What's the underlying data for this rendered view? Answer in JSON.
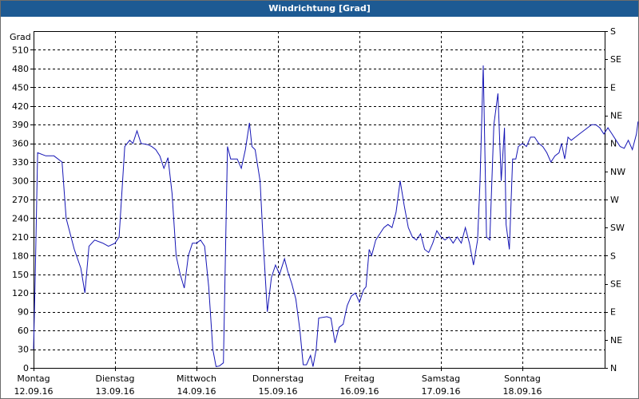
{
  "chart_data": {
    "type": "line",
    "title": "Windrichtung [Grad]",
    "ylabel": "Grad",
    "ylim": [
      0,
      540
    ],
    "y_ticks": [
      0,
      30,
      60,
      90,
      120,
      150,
      180,
      210,
      240,
      270,
      300,
      330,
      360,
      390,
      420,
      450,
      480,
      510
    ],
    "right_axis_labels": [
      {
        "value": 0,
        "label": "N"
      },
      {
        "value": 45,
        "label": "NE"
      },
      {
        "value": 90,
        "label": "E"
      },
      {
        "value": 135,
        "label": "SE"
      },
      {
        "value": 180,
        "label": "S"
      },
      {
        "value": 225,
        "label": "SW"
      },
      {
        "value": 270,
        "label": "W"
      },
      {
        "value": 315,
        "label": "NW"
      },
      {
        "value": 360,
        "label": "N"
      },
      {
        "value": 405,
        "label": "NE"
      },
      {
        "value": 450,
        "label": "E"
      },
      {
        "value": 495,
        "label": "SE"
      },
      {
        "value": 540,
        "label": "S"
      }
    ],
    "x_ticks": [
      {
        "day": "Montag",
        "date": "12.09.16"
      },
      {
        "day": "Dienstag",
        "date": "13.09.16"
      },
      {
        "day": "Mittwoch",
        "date": "14.09.16"
      },
      {
        "day": "Donnerstag",
        "date": "15.09.16"
      },
      {
        "day": "Freitag",
        "date": "16.09.16"
      },
      {
        "day": "Samstag",
        "date": "17.09.16"
      },
      {
        "day": "Sonntag",
        "date": "18.09.16"
      }
    ],
    "grid": true,
    "series": [
      {
        "color": "#1515b5",
        "points": [
          [
            0.0,
            30
          ],
          [
            0.02,
            140
          ],
          [
            0.05,
            345
          ],
          [
            0.15,
            340
          ],
          [
            0.25,
            340
          ],
          [
            0.35,
            330
          ],
          [
            0.4,
            240
          ],
          [
            0.5,
            190
          ],
          [
            0.58,
            160
          ],
          [
            0.63,
            120
          ],
          [
            0.68,
            195
          ],
          [
            0.75,
            205
          ],
          [
            0.85,
            200
          ],
          [
            0.92,
            195
          ],
          [
            1.0,
            200
          ],
          [
            1.05,
            210
          ],
          [
            1.12,
            355
          ],
          [
            1.18,
            365
          ],
          [
            1.22,
            360
          ],
          [
            1.27,
            380
          ],
          [
            1.32,
            360
          ],
          [
            1.4,
            358
          ],
          [
            1.45,
            355
          ],
          [
            1.5,
            350
          ],
          [
            1.55,
            340
          ],
          [
            1.6,
            320
          ],
          [
            1.65,
            337
          ],
          [
            1.7,
            280
          ],
          [
            1.75,
            180
          ],
          [
            1.8,
            150
          ],
          [
            1.85,
            128
          ],
          [
            1.9,
            180
          ],
          [
            1.95,
            200
          ],
          [
            2.0,
            200
          ],
          [
            2.05,
            205
          ],
          [
            2.1,
            195
          ],
          [
            2.15,
            130
          ],
          [
            2.2,
            30
          ],
          [
            2.24,
            2
          ],
          [
            2.28,
            3
          ],
          [
            2.33,
            8
          ],
          [
            2.38,
            355
          ],
          [
            2.42,
            335
          ],
          [
            2.5,
            335
          ],
          [
            2.55,
            320
          ],
          [
            2.6,
            350
          ],
          [
            2.65,
            393
          ],
          [
            2.68,
            355
          ],
          [
            2.72,
            350
          ],
          [
            2.78,
            300
          ],
          [
            2.82,
            200
          ],
          [
            2.87,
            90
          ],
          [
            2.92,
            145
          ],
          [
            2.97,
            165
          ],
          [
            3.02,
            150
          ],
          [
            3.08,
            175
          ],
          [
            3.12,
            155
          ],
          [
            3.17,
            135
          ],
          [
            3.22,
            110
          ],
          [
            3.27,
            60
          ],
          [
            3.31,
            5
          ],
          [
            3.35,
            5
          ],
          [
            3.4,
            20
          ],
          [
            3.43,
            2
          ],
          [
            3.47,
            30
          ],
          [
            3.5,
            80
          ],
          [
            3.6,
            82
          ],
          [
            3.65,
            80
          ],
          [
            3.7,
            40
          ],
          [
            3.75,
            65
          ],
          [
            3.8,
            70
          ],
          [
            3.85,
            100
          ],
          [
            3.9,
            115
          ],
          [
            3.95,
            120
          ],
          [
            4.0,
            105
          ],
          [
            4.05,
            125
          ],
          [
            4.08,
            130
          ],
          [
            4.12,
            190
          ],
          [
            4.15,
            180
          ],
          [
            4.2,
            205
          ],
          [
            4.25,
            215
          ],
          [
            4.3,
            225
          ],
          [
            4.35,
            230
          ],
          [
            4.4,
            225
          ],
          [
            4.45,
            250
          ],
          [
            4.5,
            300
          ],
          [
            4.55,
            260
          ],
          [
            4.6,
            225
          ],
          [
            4.65,
            210
          ],
          [
            4.7,
            205
          ],
          [
            4.75,
            215
          ],
          [
            4.8,
            190
          ],
          [
            4.85,
            185
          ],
          [
            4.9,
            200
          ],
          [
            4.95,
            220
          ],
          [
            5.0,
            210
          ],
          [
            5.05,
            205
          ],
          [
            5.1,
            210
          ],
          [
            5.15,
            200
          ],
          [
            5.2,
            210
          ],
          [
            5.25,
            200
          ],
          [
            5.3,
            225
          ],
          [
            5.35,
            200
          ],
          [
            5.4,
            165
          ],
          [
            5.45,
            205
          ],
          [
            5.48,
            300
          ],
          [
            5.52,
            485
          ],
          [
            5.56,
            210
          ],
          [
            5.6,
            205
          ],
          [
            5.65,
            390
          ],
          [
            5.7,
            440
          ],
          [
            5.74,
            300
          ],
          [
            5.78,
            385
          ],
          [
            5.8,
            230
          ],
          [
            5.84,
            190
          ],
          [
            5.88,
            335
          ],
          [
            5.92,
            335
          ],
          [
            5.95,
            355
          ],
          [
            6.0,
            360
          ],
          [
            6.05,
            355
          ],
          [
            6.1,
            370
          ],
          [
            6.15,
            370
          ],
          [
            6.2,
            360
          ],
          [
            6.25,
            355
          ],
          [
            6.3,
            345
          ],
          [
            6.35,
            330
          ],
          [
            6.4,
            340
          ],
          [
            6.45,
            345
          ],
          [
            6.48,
            360
          ],
          [
            6.52,
            335
          ],
          [
            6.56,
            370
          ],
          [
            6.6,
            365
          ],
          [
            6.65,
            370
          ],
          [
            6.7,
            375
          ],
          [
            6.75,
            380
          ],
          [
            6.8,
            385
          ],
          [
            6.85,
            390
          ],
          [
            6.9,
            390
          ],
          [
            6.95,
            385
          ],
          [
            7.0,
            375
          ],
          [
            7.05,
            385
          ],
          [
            7.1,
            375
          ],
          [
            7.15,
            365
          ],
          [
            7.2,
            355
          ],
          [
            7.25,
            352
          ],
          [
            7.3,
            365
          ],
          [
            7.35,
            350
          ],
          [
            7.4,
            375
          ],
          [
            7.42,
            395
          ]
        ]
      }
    ]
  }
}
